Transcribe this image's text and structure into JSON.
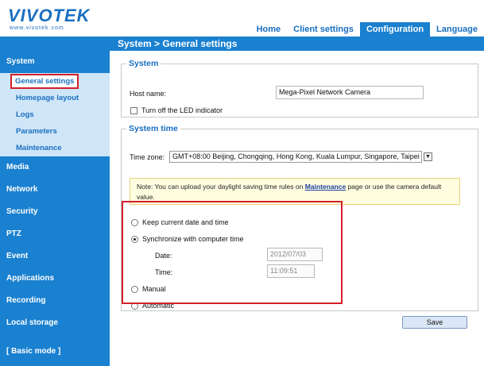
{
  "brand": {
    "logo_text": "VIVOTEK",
    "logo_sub": "www.vivotek.com"
  },
  "nav": {
    "tabs": [
      {
        "label": "Home"
      },
      {
        "label": "Client settings"
      },
      {
        "label": "Configuration"
      },
      {
        "label": "Language"
      }
    ],
    "active": "Configuration"
  },
  "title": "System  > General settings",
  "sidebar": {
    "system": "System",
    "system_items": [
      "General settings",
      "Homepage layout",
      "Logs",
      "Parameters",
      "Maintenance"
    ],
    "sections": [
      "Media",
      "Network",
      "Security",
      "PTZ",
      "Event",
      "Applications",
      "Recording",
      "Local storage"
    ],
    "basic_mode": "[ Basic mode ]"
  },
  "system_section": {
    "legend": "System",
    "host_name_label": "Host name:",
    "host_name_value": "Mega-Pixel Network Camera",
    "led_label": "Turn off the LED indicator"
  },
  "time_section": {
    "legend": "System time",
    "timezone_label": "Time zone:",
    "timezone_value": "GMT+08:00 Beijing, Chongqing, Hong Kong, Kuala Lumpur, Singapore, Taipei",
    "note_before": "Note: You can upload your daylight saving time rules on ",
    "note_link": "Maintenance",
    "note_after": " page or use the camera default value.",
    "opt_keep": "Keep current date and time",
    "opt_sync": "Synchronize with computer time",
    "date_label": "Date:",
    "date_value": "2012/07/03",
    "time_label": "Time:",
    "time_value": "11:09:51",
    "opt_manual": "Manual",
    "opt_auto": "Automatic"
  },
  "save_label": "Save",
  "colors": {
    "accent": "#1a80d0",
    "highlight": "#d3202a",
    "note_bg": "#fffde0"
  }
}
